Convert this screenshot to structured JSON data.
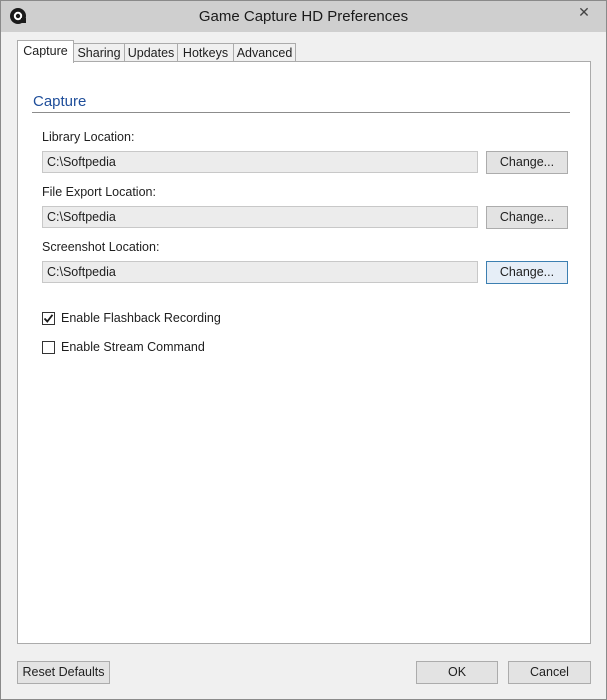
{
  "window": {
    "title": "Game Capture HD Preferences"
  },
  "tabs": [
    {
      "label": "Capture"
    },
    {
      "label": "Sharing"
    },
    {
      "label": "Updates"
    },
    {
      "label": "Hotkeys"
    },
    {
      "label": "Advanced"
    }
  ],
  "capture": {
    "section_title": "Capture",
    "library": {
      "label": "Library Location:",
      "value": "C:\\Softpedia",
      "button": "Change..."
    },
    "file_export": {
      "label": "File Export Location:",
      "value": "C:\\Softpedia",
      "button": "Change..."
    },
    "screenshot": {
      "label": "Screenshot Location:",
      "value": "C:\\Softpedia",
      "button": "Change..."
    },
    "flashback": {
      "label": "Enable Flashback Recording",
      "checked": true
    },
    "stream_command": {
      "label": "Enable Stream Command",
      "checked": false
    }
  },
  "footer": {
    "reset_label": "Reset Defaults",
    "ok_label": "OK",
    "cancel_label": "Cancel"
  }
}
